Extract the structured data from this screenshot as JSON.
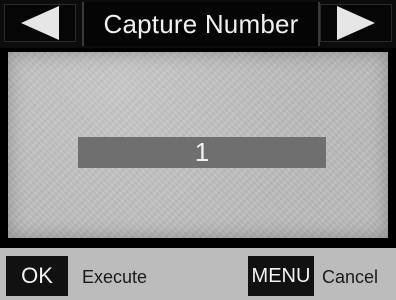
{
  "header": {
    "title": "Capture Number",
    "prev_icon": "left-arrow-icon",
    "next_icon": "right-arrow-icon"
  },
  "main": {
    "value": "1"
  },
  "footer": {
    "ok_key_label": "OK",
    "ok_action": "Execute",
    "menu_key_label": "MENU",
    "menu_action": "Cancel"
  },
  "colors": {
    "header_bg": "#0c0c0c",
    "panel_bg": "#bdbdbd",
    "value_bar": "#6f6f6f",
    "footer_bg": "#bcbcbc"
  }
}
